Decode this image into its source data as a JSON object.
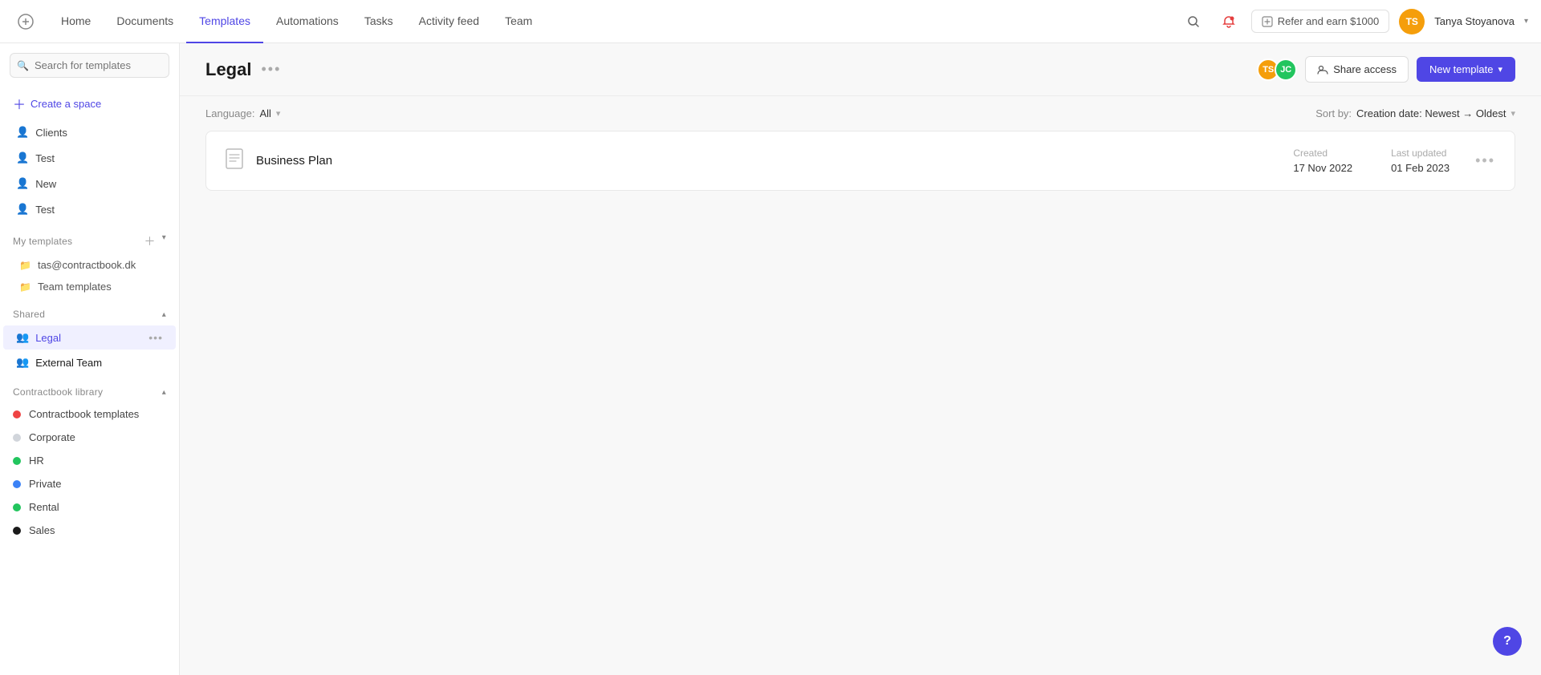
{
  "nav": {
    "items": [
      {
        "label": "Home",
        "active": false
      },
      {
        "label": "Documents",
        "active": false
      },
      {
        "label": "Templates",
        "active": true
      },
      {
        "label": "Automations",
        "active": false
      },
      {
        "label": "Tasks",
        "active": false
      },
      {
        "label": "Activity feed",
        "active": false
      },
      {
        "label": "Team",
        "active": false
      }
    ],
    "refer_label": "Refer and earn $1000",
    "user_name": "Tanya Stoyanova",
    "user_initials": "TS"
  },
  "sidebar": {
    "search_placeholder": "Search for templates",
    "create_space_label": "Create a space",
    "nav_items": [
      {
        "label": "Clients"
      },
      {
        "label": "Test"
      },
      {
        "label": "New"
      },
      {
        "label": "Test"
      }
    ],
    "my_templates_label": "My templates",
    "my_templates_items": [
      {
        "label": "tas@contractbook.dk"
      },
      {
        "label": "Team templates"
      }
    ],
    "shared_label": "Shared",
    "shared_items": [
      {
        "label": "Legal",
        "active": true
      },
      {
        "label": "External Team",
        "active": false
      }
    ],
    "library_label": "Contractbook library",
    "library_items": [
      {
        "label": "Contractbook templates",
        "dot_color": "#ef4444"
      },
      {
        "label": "Corporate",
        "dot_color": "#d1d5db"
      },
      {
        "label": "HR",
        "dot_color": "#22c55e"
      },
      {
        "label": "Private",
        "dot_color": "#3b82f6"
      },
      {
        "label": "Rental",
        "dot_color": "#22c55e"
      },
      {
        "label": "Sales",
        "dot_color": "#1a1a1a"
      }
    ]
  },
  "page": {
    "title": "Legal",
    "avatar1_initials": "TS",
    "avatar1_color": "#f59e0b",
    "avatar2_initials": "JC",
    "avatar2_color": "#22c55e",
    "share_access_label": "Share access",
    "new_template_label": "New template",
    "language_label": "Language:",
    "language_value": "All",
    "sort_label": "Sort by:",
    "sort_value": "Creation date: Newest → Oldest"
  },
  "templates": [
    {
      "name": "Business Plan",
      "created_label": "Created",
      "created_value": "17 Nov 2022",
      "updated_label": "Last updated",
      "updated_value": "01 Feb 2023"
    }
  ],
  "help": {
    "label": "?"
  }
}
